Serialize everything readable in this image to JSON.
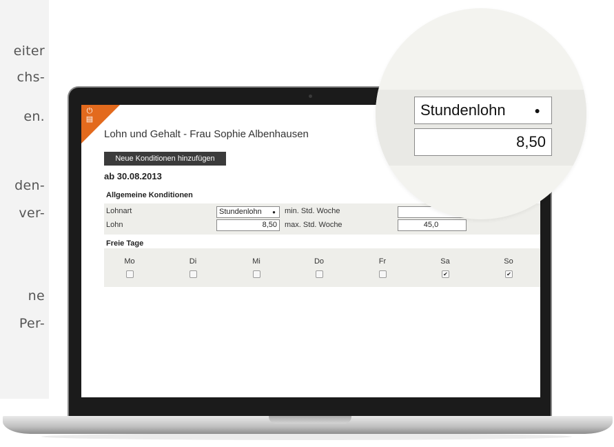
{
  "side_text": [
    "eiter",
    "chs-",
    "en.",
    "den-",
    "ver-",
    "ne",
    "Per-"
  ],
  "app": {
    "title": "Lohn und Gehalt - Frau Sophie Albenhausen",
    "add_button_label": "Neue Konditionen hinzufügen",
    "date_heading": "ab 30.08.2013",
    "general_section_label": "Allgemeine Konditionen",
    "wage_type_label": "Lohnart",
    "wage_type_value": "Stundenlohn",
    "wage_label": "Lohn",
    "wage_value": "8,50",
    "min_hours_label": "min. Std. Woche",
    "min_hours_value": "",
    "max_hours_label": "max. Std. Woche",
    "max_hours_value": "45,0",
    "free_days_label": "Freie Tage",
    "days": [
      {
        "label": "Mo",
        "checked": false
      },
      {
        "label": "Di",
        "checked": false
      },
      {
        "label": "Mi",
        "checked": false
      },
      {
        "label": "Do",
        "checked": false
      },
      {
        "label": "Fr",
        "checked": false
      },
      {
        "label": "Sa",
        "checked": true
      },
      {
        "label": "So",
        "checked": true
      }
    ]
  },
  "magnifier": {
    "select_value": "Stundenlohn",
    "input_value": "8,50"
  },
  "colors": {
    "accent": "#e36a1d",
    "button": "#3b3b3b",
    "panel": "#eeeeea"
  },
  "icons": [
    "dropdown-arrow-icon",
    "app-corner-icon",
    "checkmark-icon"
  ]
}
